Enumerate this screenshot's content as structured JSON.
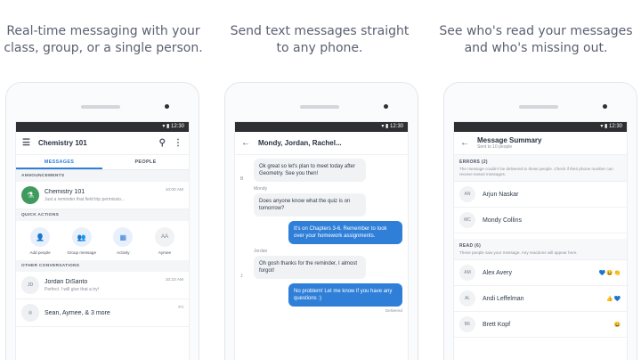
{
  "captions": [
    "Real-time messaging with your\nclass, group, or a single person.",
    "Send text messages straight\nto any phone.",
    "See who's read your messages\nand who's missing out."
  ],
  "status_time": "12:30",
  "screen1": {
    "title": "Chemistry 101",
    "tabs": [
      "MESSAGES",
      "PEOPLE"
    ],
    "announcements_header": "ANNOUNCEMENTS",
    "announcement": {
      "title": "Chemistry 101",
      "preview": "Just a reminder that field trip permissio...",
      "time": "10:00 AM"
    },
    "quick_actions_header": "QUICK ACTIONS",
    "actions": [
      "Add people",
      "Group message",
      "Activity",
      "Aymee"
    ],
    "other_header": "OTHER CONVERSATIONS",
    "conversations": [
      {
        "initials": "JD",
        "name": "Jordan DiSanto",
        "preview": "Perfect. I will give that a try!",
        "time": "10:23 AM"
      },
      {
        "initials": "",
        "name": "Sean, Aymee, & 3 more",
        "preview": "",
        "time": "Fri"
      }
    ]
  },
  "screen2": {
    "title": "Mondy, Jordan, Rachel...",
    "messages": [
      {
        "dir": "in",
        "mini": "B",
        "sender": "",
        "text": "Ok great so let's plan to meet today after Geometry. See you then!"
      },
      {
        "dir": "in",
        "mini": "",
        "sender": "Mondy",
        "text": "Does anyone know what the quiz is on tomorrow?"
      },
      {
        "dir": "out",
        "text": "It's on Chapters 3-6. Remember to look over your homework assignments."
      },
      {
        "dir": "in",
        "mini": "J",
        "sender": "Jordan",
        "text": "Oh gosh thanks for the reminder, I almost forgot!"
      },
      {
        "dir": "out",
        "text": "No problem! Let me know if you have any questions :)"
      }
    ],
    "delivered": "Delivered"
  },
  "screen3": {
    "title": "Message Summary",
    "subtitle": "Sent to 10 people",
    "errors_label": "ERRORS (2)",
    "errors_desc": "The message couldn't be delivered to these people. Check if their phone number can receive texted messages.",
    "errors": [
      {
        "initials": "AN",
        "name": "Arjun Naskar"
      },
      {
        "initials": "MC",
        "name": "Mondy Collins"
      }
    ],
    "read_label": "READ (6)",
    "read_desc": "These people saw your message. Any reactions will appear here.",
    "read": [
      {
        "initials": "AM",
        "name": "Alex Avery",
        "reactions": "💙😀👏"
      },
      {
        "initials": "AL",
        "name": "Andi Leffelman",
        "reactions": "👍💙"
      },
      {
        "initials": "BK",
        "name": "Brett Kopf",
        "reactions": "😀"
      }
    ]
  }
}
